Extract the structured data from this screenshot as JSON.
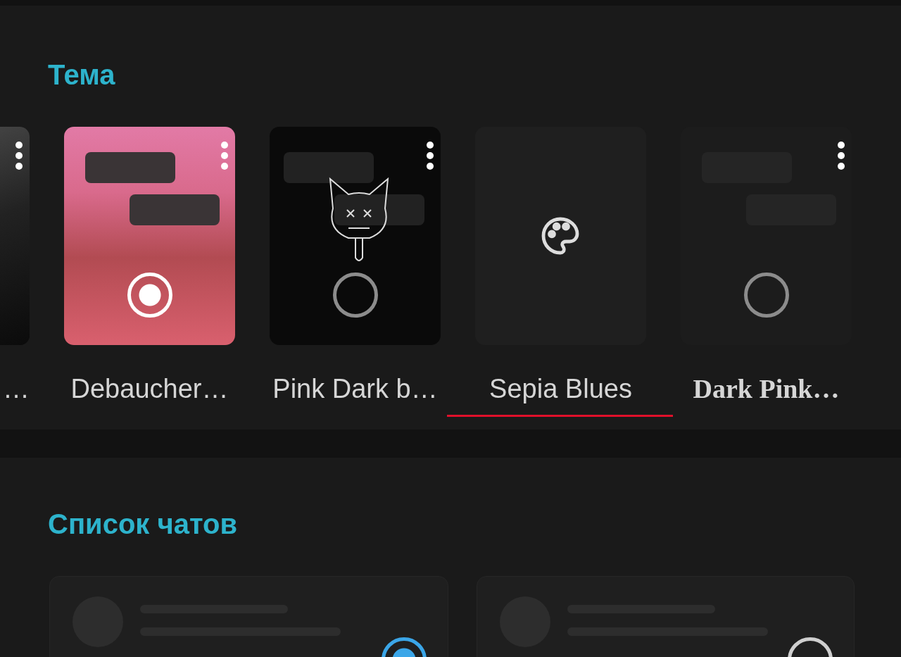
{
  "theme_section": {
    "title": "Тема",
    "themes": [
      {
        "label": "…",
        "kind": "photo-dark"
      },
      {
        "label": "Debaucher…",
        "kind": "photo-pink",
        "selected": true
      },
      {
        "label": "Pink Dark b…",
        "kind": "black",
        "selected": false
      },
      {
        "label": "Sepia Blues",
        "kind": "create",
        "underlined": true
      },
      {
        "label": "Dark Pink…",
        "kind": "custom",
        "selected": false
      }
    ]
  },
  "chat_list_section": {
    "title": "Список чатов",
    "styles": [
      {
        "selected": true
      },
      {
        "selected": false
      }
    ]
  }
}
